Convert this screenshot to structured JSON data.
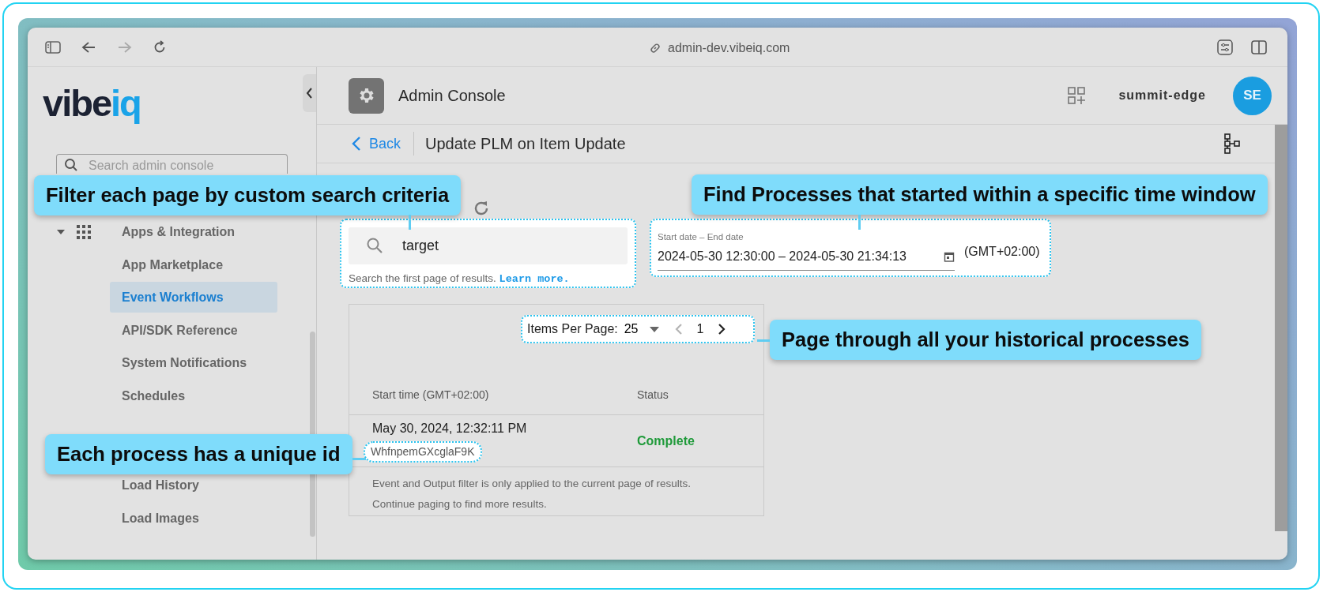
{
  "browser": {
    "url": "admin-dev.vibeiq.com"
  },
  "sidebar": {
    "logo": {
      "dark": "vibe",
      "accent": "iq"
    },
    "search": {
      "placeholder": "Search admin console"
    },
    "items": [
      {
        "label": "Apps & Integration",
        "kind": "group",
        "expanded": true,
        "selected": false
      },
      {
        "label": "App Marketplace",
        "kind": "link",
        "selected": false
      },
      {
        "label": "Event Workflows",
        "kind": "link",
        "selected": true
      },
      {
        "label": "API/SDK Reference",
        "kind": "link",
        "selected": false
      },
      {
        "label": "System Notifications",
        "kind": "link",
        "selected": false
      },
      {
        "label": "Schedules",
        "kind": "link",
        "selected": false
      },
      {
        "label": "Load History",
        "kind": "link",
        "selected": false
      },
      {
        "label": "Load Images",
        "kind": "link",
        "selected": false
      }
    ]
  },
  "header": {
    "title": "Admin Console",
    "workspace": "summit-edge",
    "avatar": "SE"
  },
  "subheader": {
    "back": "Back",
    "title": "Update PLM on Item Update"
  },
  "search": {
    "value": "target",
    "helper": "Search the first page of results.",
    "link": "Learn more."
  },
  "date_range": {
    "label": "Start date – End date",
    "value": "2024-05-30 12:30:00 – 2024-05-30 21:34:13",
    "timezone": "(GMT+02:00)"
  },
  "pager": {
    "label": "Items Per Page:",
    "page_size": "25",
    "page": "1",
    "prev": {
      "disabled": true
    },
    "next": {
      "disabled": false
    }
  },
  "table": {
    "columns": [
      "Start time (GMT+02:00)",
      "Status"
    ],
    "rows": [
      {
        "start": "May 30, 2024, 12:32:11 PM",
        "id": "WhfnpemGXcglaF9K",
        "status": "Complete",
        "color": "#1f9a3a"
      }
    ],
    "note": [
      "Event and Output filter is only applied to the current page of results.",
      "Continue paging to find more results."
    ]
  },
  "callouts": [
    "Filter each page by custom search criteria",
    "Find Processes that started within a specific time window",
    "Page through all your historical processes",
    "Each process has a unique id"
  ]
}
